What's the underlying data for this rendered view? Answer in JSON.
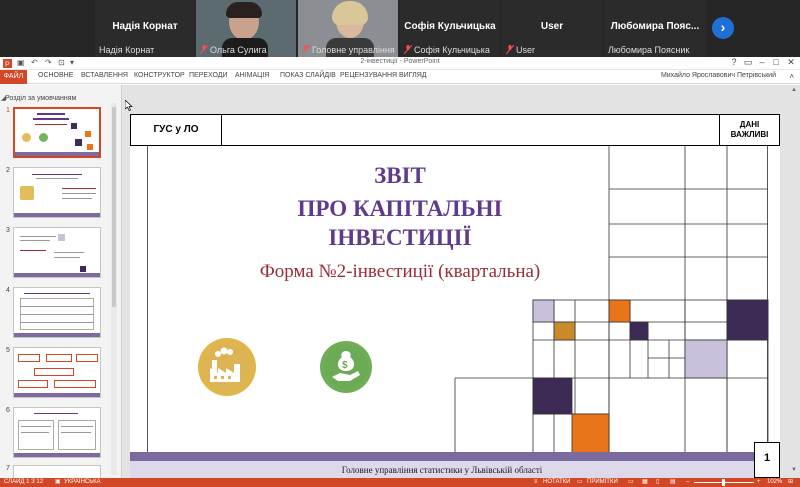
{
  "conference": {
    "tiles": [
      {
        "big": "Надія Корнат",
        "small": "Надія Корнат"
      },
      {
        "small": "Ольга Сулига"
      },
      {
        "small": "Головне управління ..."
      },
      {
        "big": "Софія Кульчицька",
        "small": "Софія Кульчицька"
      },
      {
        "big": "User",
        "small": "User"
      },
      {
        "big": "Любомира Пояс...",
        "small": "Любомира Поясник"
      }
    ],
    "next_icon": "›"
  },
  "window": {
    "title": "2-інвестиції - PowerPoint",
    "controls": [
      "?",
      "▭",
      "–",
      "□",
      "✕"
    ]
  },
  "ribbon": {
    "file": "ФАЙЛ",
    "tabs": [
      "ОСНОВНЕ",
      "ВСТАВЛЕННЯ",
      "КОНСТРУКТОР",
      "ПЕРЕХОДИ",
      "АНІМАЦІЯ",
      "ПОКАЗ СЛАЙДІВ",
      "РЕЦЕНЗУВАННЯ",
      "ВИГЛЯД"
    ],
    "user": "Михайло Ярославович Петрівський"
  },
  "thumbnails": {
    "section": "Розділ за умовчанням",
    "numbers": [
      "1",
      "2",
      "3",
      "4",
      "5",
      "6",
      "7"
    ]
  },
  "slide": {
    "header_left": "ГУС у ЛО",
    "header_right_1": "ДАНІ",
    "header_right_2": "ВАЖЛИВІ",
    "title_1": "ЗВІТ",
    "title_2": "ПРО КАПІТАЛЬНІ",
    "title_3": "ІНВЕСТИЦІЇ",
    "subtitle": "Форма №2-інвестиції (квартальна)",
    "footer": "Головне управління статистики у Львівській області",
    "page_number": "1"
  },
  "status": {
    "slide": "СЛАЙД 1 З 12",
    "language": "УКРАЇНСЬКА",
    "notes": "НОТАТКИ",
    "comments": "ПРИМІТКИ",
    "zoom": "102%"
  },
  "colors": {
    "accent": "#d24726",
    "title": "#5f3b8c",
    "subtitle": "#9b2c35",
    "dark_square": "#3d2a55",
    "orange_square": "#e8751a",
    "light_purple": "#c9c0dc",
    "gold": "#c98a2a"
  }
}
